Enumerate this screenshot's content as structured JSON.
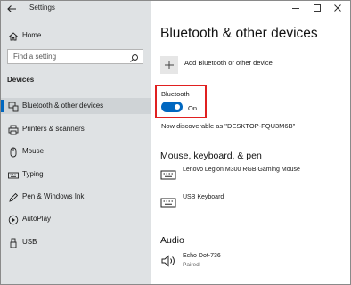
{
  "window": {
    "title": "Settings"
  },
  "sidebar": {
    "home_label": "Home",
    "search_placeholder": "Find a setting",
    "section_heading": "Devices",
    "items": [
      {
        "label": "Bluetooth & other devices",
        "icon": "bluetooth-devices-icon",
        "selected": true
      },
      {
        "label": "Printers & scanners",
        "icon": "printer-icon",
        "selected": false
      },
      {
        "label": "Mouse",
        "icon": "mouse-icon",
        "selected": false
      },
      {
        "label": "Typing",
        "icon": "keyboard-icon",
        "selected": false
      },
      {
        "label": "Pen & Windows Ink",
        "icon": "pen-icon",
        "selected": false
      },
      {
        "label": "AutoPlay",
        "icon": "autoplay-icon",
        "selected": false
      },
      {
        "label": "USB",
        "icon": "usb-icon",
        "selected": false
      }
    ]
  },
  "main": {
    "title": "Bluetooth & other devices",
    "add_device_label": "Add Bluetooth or other device",
    "bluetooth": {
      "label": "Bluetooth",
      "toggle_state": "On",
      "enabled": true,
      "discoverable_text": "Now discoverable as \"DESKTOP-FQU3M6B\""
    },
    "groups": [
      {
        "heading": "Mouse, keyboard, & pen",
        "devices": [
          {
            "name": "Lenovo Legion M300 RGB Gaming Mouse",
            "status": "",
            "icon": "keyboard-icon"
          },
          {
            "name": "USB Keyboard",
            "status": "",
            "icon": "keyboard-icon"
          }
        ]
      },
      {
        "heading": "Audio",
        "devices": [
          {
            "name": "Echo Dot-736",
            "status": "Paired",
            "icon": "speaker-icon"
          }
        ]
      }
    ]
  },
  "colors": {
    "accent": "#0067c0",
    "highlight_box": "#e02020",
    "sidebar_bg": "#dfe2e4"
  }
}
